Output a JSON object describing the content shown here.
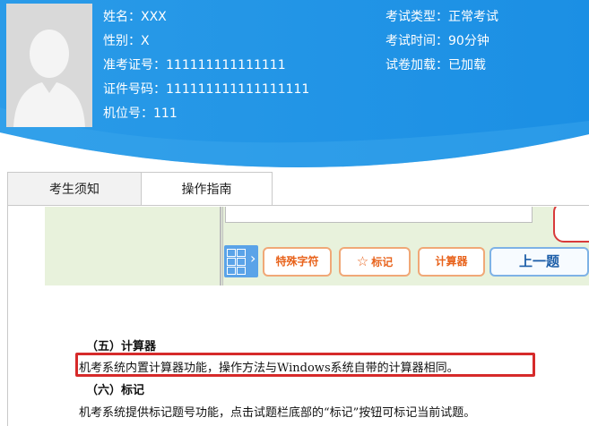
{
  "candidate": {
    "name": "姓名：XXX",
    "gender": "性别：X",
    "admission_no": "准考证号：111111111111111",
    "id_no": "证件号码：111111111111111111",
    "seat_no": "机位号：111"
  },
  "exam": {
    "type": "考试类型：正常考试",
    "duration": "考试时间：90分钟",
    "paper_status": "试卷加载：已加载"
  },
  "tabs": [
    {
      "label": "考生须知"
    },
    {
      "label": "操作指南"
    }
  ],
  "toolbar": {
    "special_chars": "特殊字符",
    "mark": "标记",
    "calculator": "计算器",
    "prev": "上一题",
    "dropdown_arrow": "▼"
  },
  "guide": {
    "section5_title": "（五）计算器",
    "section5_text": "机考系统内置计算器功能，操作方法与Windows系统自带的计算器相同。",
    "section6_title": "（六）标记",
    "section6_text": "机考系统提供标记题号功能，点击试题栏底部的“标记”按钮可标记当前试题。"
  },
  "colors": {
    "header_blue": "#1e90e6",
    "highlight_red": "#d62a2a",
    "tool_orange": "#e8631c"
  }
}
